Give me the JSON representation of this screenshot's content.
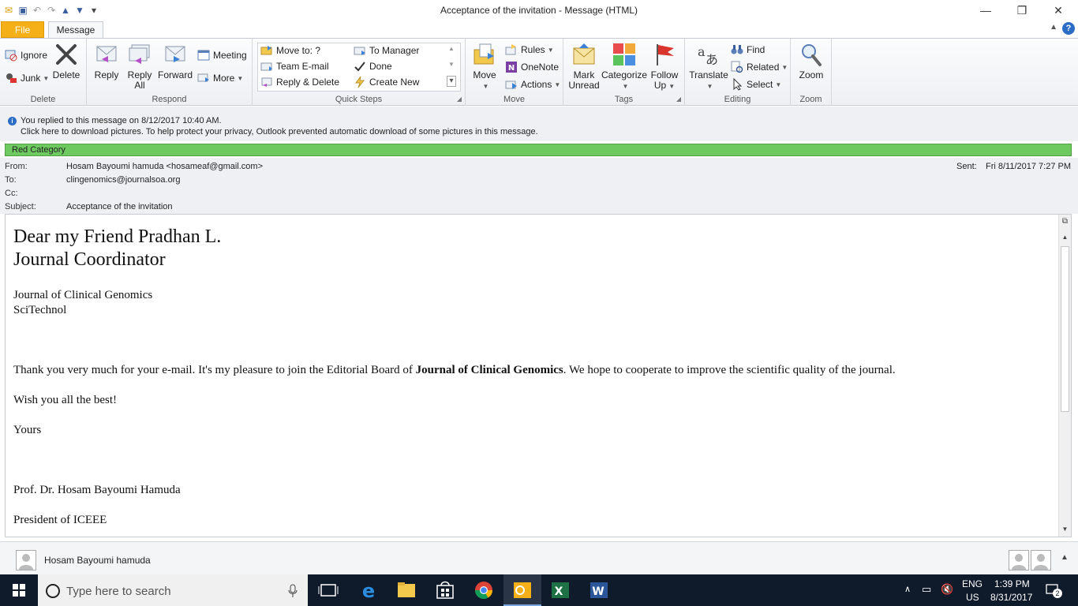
{
  "window": {
    "title": "Acceptance of the invitation  -  Message (HTML)",
    "minimize": "—",
    "restore": "❐",
    "close": "✕"
  },
  "tabs": {
    "file": "File",
    "message": "Message"
  },
  "ribbon": {
    "delete_group": {
      "label": "Delete",
      "ignore": "Ignore",
      "junk": "Junk",
      "delete": "Delete"
    },
    "respond_group": {
      "label": "Respond",
      "reply": "Reply",
      "reply_all_1": "Reply",
      "reply_all_2": "All",
      "forward": "Forward",
      "meeting": "Meeting",
      "more": "More"
    },
    "quicksteps_group": {
      "label": "Quick Steps",
      "move_to": "Move to: ?",
      "team_email": "Team E-mail",
      "reply_delete": "Reply & Delete",
      "to_manager": "To Manager",
      "done": "Done",
      "create_new": "Create New"
    },
    "move_group": {
      "label": "Move",
      "move": "Move",
      "rules": "Rules",
      "onenote": "OneNote",
      "actions": "Actions"
    },
    "tags_group": {
      "label": "Tags",
      "mark_unread_1": "Mark",
      "mark_unread_2": "Unread",
      "categorize": "Categorize",
      "follow_up_1": "Follow",
      "follow_up_2": "Up"
    },
    "editing_group": {
      "label": "Editing",
      "translate": "Translate",
      "find": "Find",
      "related": "Related",
      "select": "Select"
    },
    "zoom_group": {
      "label": "Zoom",
      "zoom": "Zoom"
    }
  },
  "info": {
    "line1": "You replied to this message on 8/12/2017 10:40 AM.",
    "line2": "Click here to download pictures. To help protect your privacy, Outlook prevented automatic download of some pictures in this message."
  },
  "category": "Red Category",
  "header": {
    "from_label": "From:",
    "from_value": "Hosam Bayoumi hamuda <hosameaf@gmail.com>",
    "to_label": "To:",
    "to_value": "clingenomics@journalsoa.org",
    "cc_label": "Cc:",
    "subject_label": "Subject:",
    "subject_value": "Acceptance of the invitation",
    "sent_label": "Sent:",
    "sent_value": "Fri 8/11/2017 7:27 PM"
  },
  "body": {
    "greeting": "Dear my Friend Pradhan L.",
    "role": "Journal Coordinator",
    "journal": "Journal of Clinical Genomics",
    "org": "SciTechnol",
    "para_start": "Thank you very much for your e-mail. It's my pleasure to join the Editorial Board of ",
    "para_bold": "Journal of Clinical Genomics",
    "para_end": ". We hope to cooperate to improve the scientific quality of the journal.",
    "wish": "Wish you all the best!",
    "yours": "Yours",
    "sig_name": "Prof. Dr. Hosam Bayoumi Hamuda",
    "sig_title": "President of ICEEE"
  },
  "people": {
    "name": "Hosam Bayoumi hamuda"
  },
  "taskbar": {
    "search_placeholder": "Type here to search",
    "lang1": "ENG",
    "lang2": "US",
    "time": "1:39 PM",
    "date": "8/31/2017",
    "notifications": "2"
  },
  "colors": {
    "file_tab": "#f4b016",
    "category": "#6ec960",
    "taskbar": "#0f1a2b"
  }
}
